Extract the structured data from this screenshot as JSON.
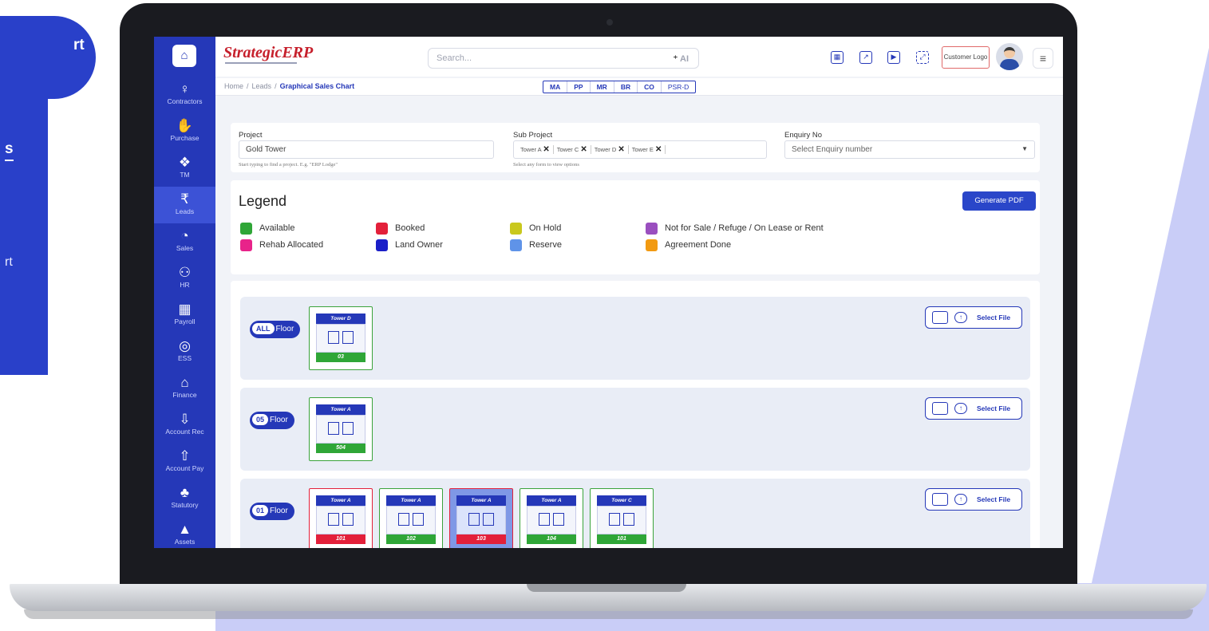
{
  "promo": {
    "card_text": "rt",
    "link_text": "s",
    "item_text": "rt"
  },
  "app": {
    "logo": "StrategicERP",
    "search_placeholder": "Search...",
    "ai_label": "AI",
    "customer_logo": "Customer Logo"
  },
  "sidebar": {
    "items": [
      {
        "label": "Contractors",
        "icon": "hardhat-icon",
        "glyph": "♀"
      },
      {
        "label": "Purchase",
        "icon": "hand-coin-icon",
        "glyph": "✋"
      },
      {
        "label": "TM",
        "icon": "network-icon",
        "glyph": "❖"
      },
      {
        "label": "Leads",
        "icon": "rupee-doc-icon",
        "glyph": "₹"
      },
      {
        "label": "Sales",
        "icon": "pie-icon",
        "glyph": "◔"
      },
      {
        "label": "HR",
        "icon": "people-icon",
        "glyph": "⚇"
      },
      {
        "label": "Payroll",
        "icon": "payroll-icon",
        "glyph": "▦"
      },
      {
        "label": "ESS",
        "icon": "ess-icon",
        "glyph": "◎"
      },
      {
        "label": "Finance",
        "icon": "finance-icon",
        "glyph": "⌂"
      },
      {
        "label": "Account Rec",
        "icon": "download-icon",
        "glyph": "⇩"
      },
      {
        "label": "Account Pay",
        "icon": "upload-icon",
        "glyph": "⇧"
      },
      {
        "label": "Statutory",
        "icon": "hierarchy-icon",
        "glyph": "♣"
      },
      {
        "label": "Assets",
        "icon": "assets-icon",
        "glyph": "▲"
      }
    ]
  },
  "breadcrumb": {
    "home": "Home",
    "leads": "Leads",
    "current": "Graphical Sales Chart"
  },
  "tabs": [
    "MA",
    "PP",
    "MR",
    "BR",
    "CO",
    "PSR-D"
  ],
  "form": {
    "project_label": "Project",
    "project_value": "Gold Tower",
    "project_hint": "Start typing to find a project. E.g. \"ERP Lodge\"",
    "subproject_label": "Sub Project",
    "subprojects": [
      "Tower A",
      "Tower C",
      "Tower D",
      "Tower E"
    ],
    "subproject_hint": "Select any form to view options",
    "enquiry_label": "Enquiry No",
    "enquiry_placeholder": "Select Enquiry number"
  },
  "legend": {
    "title": "Legend",
    "generate_pdf": "Generate PDF",
    "items": [
      {
        "label": "Available",
        "color": "#2fa637"
      },
      {
        "label": "Booked",
        "color": "#e3203a"
      },
      {
        "label": "On Hold",
        "color": "#c9c81e"
      },
      {
        "label": "Not for Sale / Refuge / On Lease or Rent",
        "color": "#9a4fbf"
      },
      {
        "label": "Rehab Allocated",
        "color": "#e8238a"
      },
      {
        "label": "Land Owner",
        "color": "#1b1fc8"
      },
      {
        "label": "Reserve",
        "color": "#5f93e8"
      },
      {
        "label": "Agreement Done",
        "color": "#f29a12"
      }
    ]
  },
  "floors": [
    {
      "tag": "ALL",
      "label": "Floor",
      "select_file": "Select File",
      "units": [
        {
          "tower": "Tower D",
          "no": "03",
          "status": "available"
        }
      ]
    },
    {
      "tag": "05",
      "label": "Floor",
      "select_file": "Select File",
      "units": [
        {
          "tower": "Tower A",
          "no": "504",
          "status": "available"
        }
      ]
    },
    {
      "tag": "01",
      "label": "Floor",
      "select_file": "Select File",
      "units": [
        {
          "tower": "Tower A",
          "no": "101",
          "status": "booked"
        },
        {
          "tower": "Tower A",
          "no": "102",
          "status": "available"
        },
        {
          "tower": "Tower A",
          "no": "103",
          "status": "booked-selected"
        },
        {
          "tower": "Tower A",
          "no": "104",
          "status": "available"
        },
        {
          "tower": "Tower C",
          "no": "101",
          "status": "available"
        }
      ]
    }
  ]
}
